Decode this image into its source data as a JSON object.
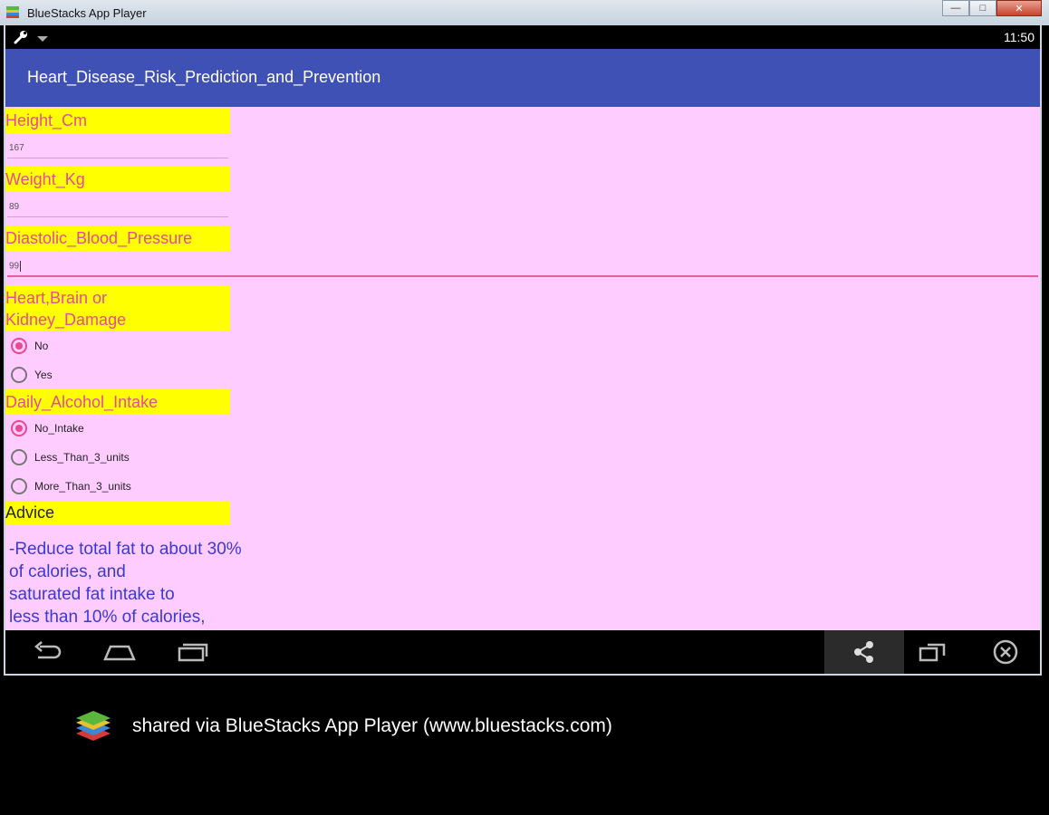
{
  "window": {
    "title": "BlueStacks App Player",
    "controls": {
      "minimize": "—",
      "maximize": "□",
      "close": "✕"
    }
  },
  "statusbar": {
    "time": "11:50",
    "icons": [
      "wrench-icon",
      "notification-icon"
    ]
  },
  "app": {
    "title": "Heart_Disease_Risk_Prediction_and_Prevention"
  },
  "form": {
    "height": {
      "label": "Height_Cm",
      "value": "167"
    },
    "weight": {
      "label": "Weight_Kg",
      "value": "89"
    },
    "diastolic": {
      "label": "Diastolic_Blood_Pressure",
      "value": "99"
    },
    "damage": {
      "label_line1": "Heart,Brain or",
      "label_line2": "Kidney_Damage",
      "options": [
        {
          "label": "No",
          "checked": true
        },
        {
          "label": "Yes",
          "checked": false
        }
      ]
    },
    "alcohol": {
      "label": "Daily_Alcohol_Intake",
      "options": [
        {
          "label": "No_Intake",
          "checked": true
        },
        {
          "label": "Less_Than_3_units",
          "checked": false
        },
        {
          "label": "More_Than_3_units",
          "checked": false
        }
      ]
    },
    "advice": {
      "label": "Advice",
      "lines": [
        "-Reduce total fat to about 30%",
        "of calories,  and",
        "saturated fat intake to",
        "less than 10% of calories,"
      ]
    }
  },
  "navbar": {
    "icons": [
      "back-icon",
      "home-icon",
      "recent-apps-icon",
      "share-icon",
      "window-resize-icon",
      "close-circle-icon"
    ]
  },
  "footer": {
    "shared_text": "shared via BlueStacks App Player (www.bluestacks.com)"
  },
  "colors": {
    "actionbar": "#3f51b5",
    "content_bg": "#ffccff",
    "label_bg": "#ffff00",
    "label_text": "#e64aa0",
    "accent": "#e84a8f",
    "advice_text": "#3a3ad0"
  }
}
